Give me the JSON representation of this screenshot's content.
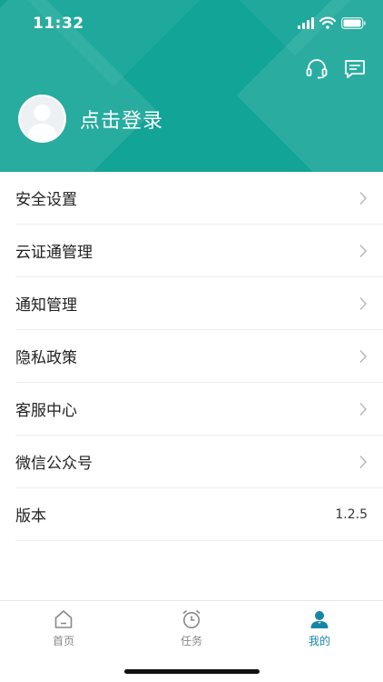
{
  "status_bar": {
    "time": "11:32"
  },
  "header": {
    "login_text": "点击登录",
    "icons": [
      "headset-icon",
      "message-icon"
    ],
    "accent_color": "#12a496"
  },
  "menu": {
    "items": [
      {
        "label": "安全设置"
      },
      {
        "label": "云证通管理"
      },
      {
        "label": "通知管理"
      },
      {
        "label": "隐私政策"
      },
      {
        "label": "客服中心"
      },
      {
        "label": "微信公众号"
      }
    ],
    "version": {
      "label": "版本",
      "value": "1.2.5"
    }
  },
  "tabbar": {
    "tabs": [
      {
        "label": "首页",
        "icon": "home-icon"
      },
      {
        "label": "任务",
        "icon": "alarm-clock-icon"
      },
      {
        "label": "我的",
        "icon": "user-icon",
        "active": true
      }
    ],
    "active_color": "#1586a8"
  }
}
